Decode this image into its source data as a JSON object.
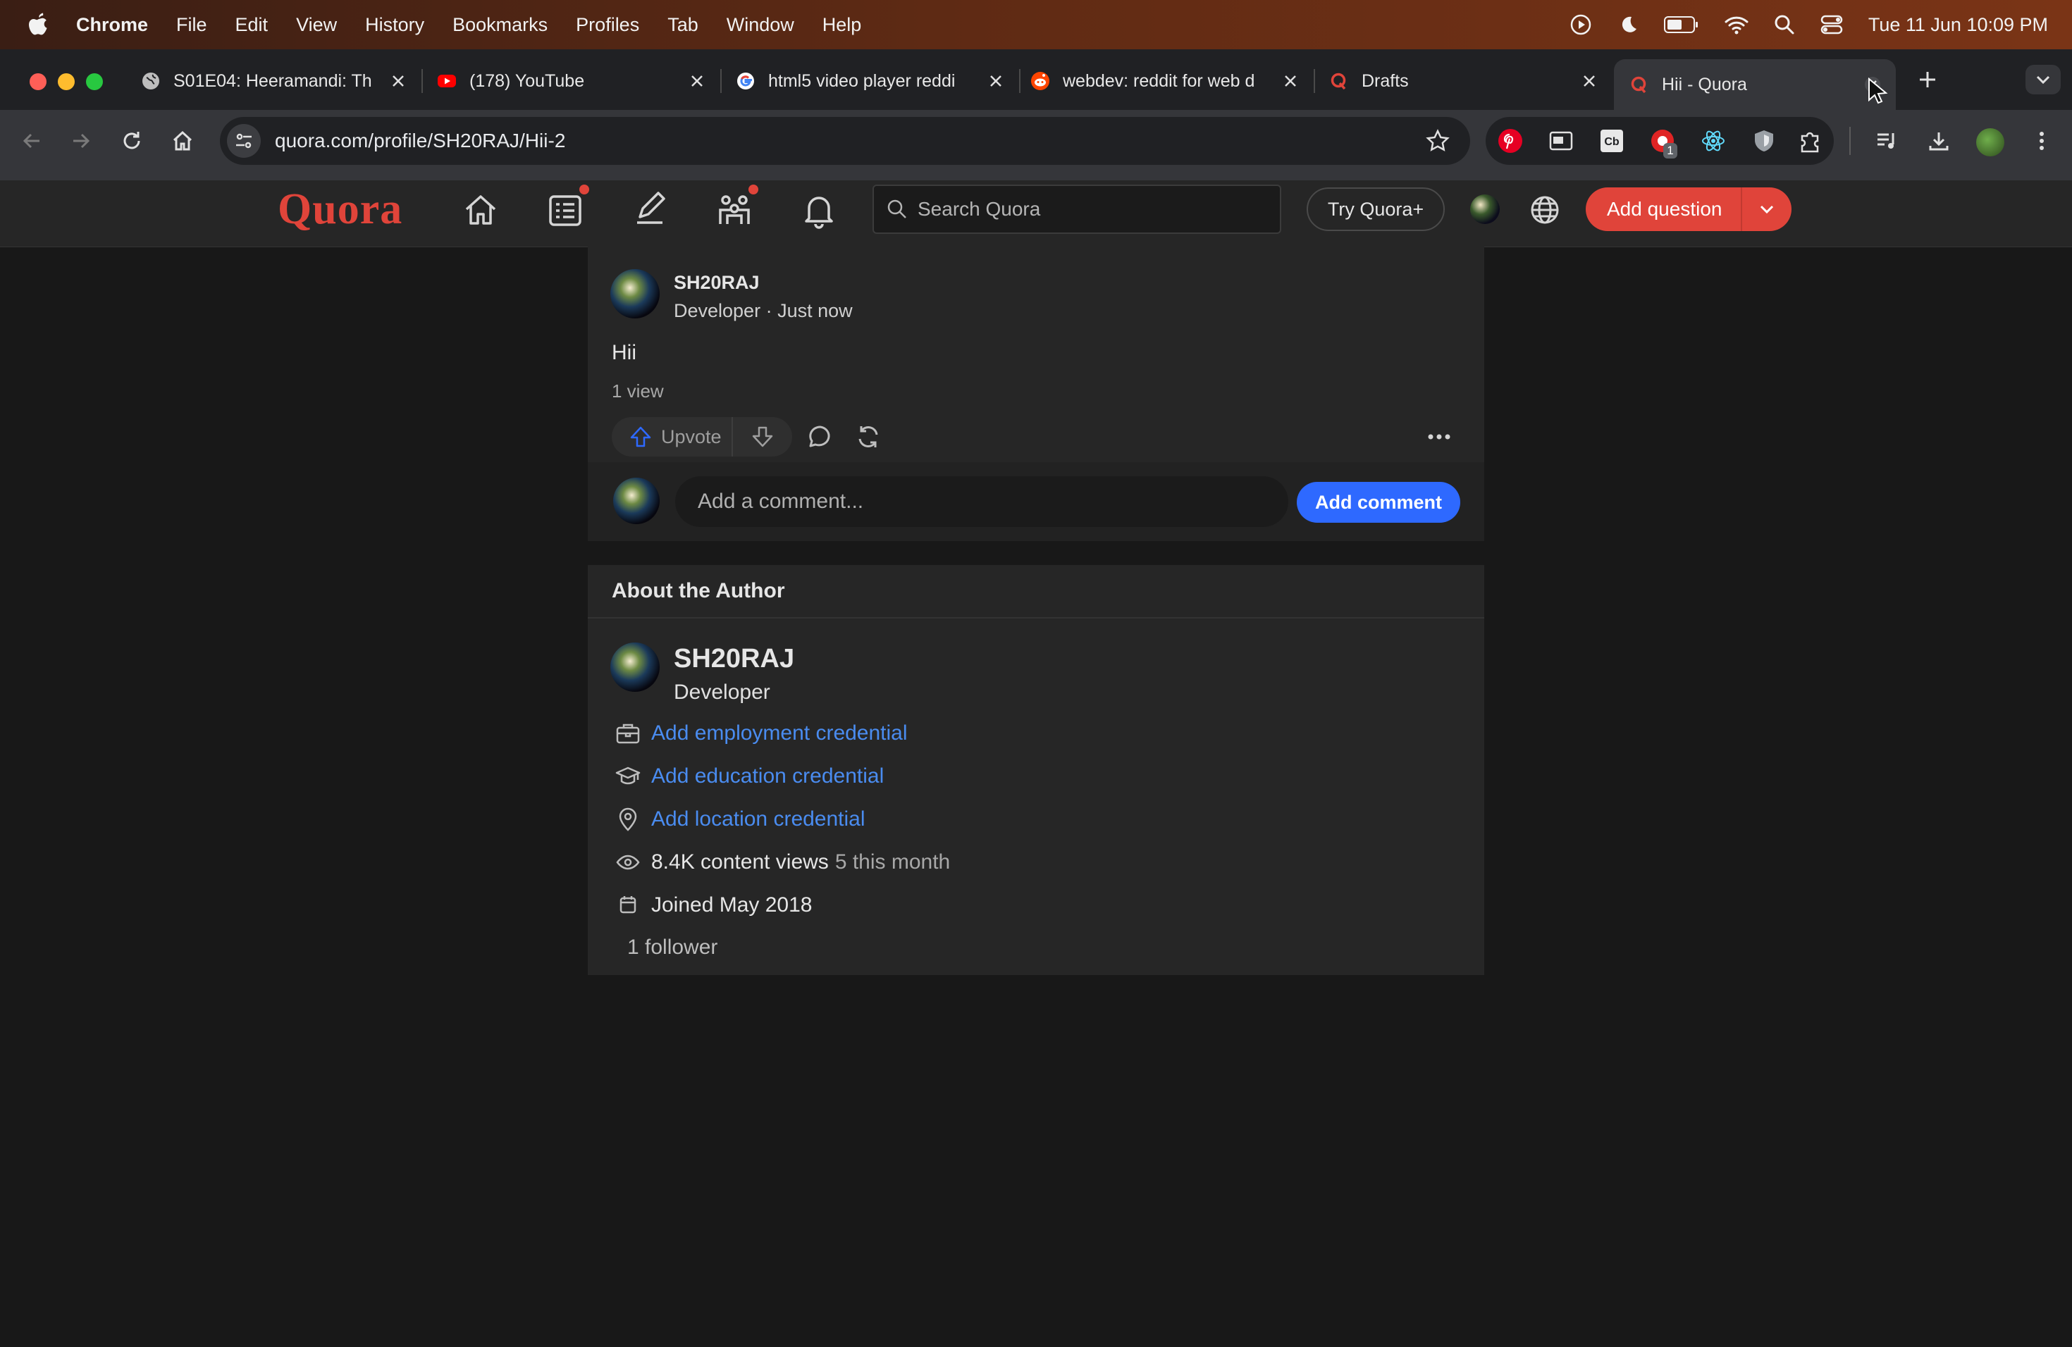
{
  "menubar": {
    "app_name": "Chrome",
    "menus": [
      "File",
      "Edit",
      "View",
      "History",
      "Bookmarks",
      "Profiles",
      "Tab",
      "Window",
      "Help"
    ],
    "clock": "Tue 11 Jun  10:09 PM"
  },
  "tabs": [
    {
      "title": "S01E04: Heeramandi: Th",
      "favicon": "globe-icon"
    },
    {
      "title": "(178) YouTube",
      "favicon": "youtube-icon"
    },
    {
      "title": "html5 video player reddi",
      "favicon": "google-icon"
    },
    {
      "title": "webdev: reddit for web d",
      "favicon": "reddit-icon"
    },
    {
      "title": "Drafts",
      "favicon": "quora-icon"
    },
    {
      "title": "Hii - Quora",
      "favicon": "quora-icon",
      "active": true
    }
  ],
  "address_bar": {
    "url": "quora.com/profile/SH20RAJ/Hii-2"
  },
  "extensions": {
    "badge_count": "1"
  },
  "quora_header": {
    "logo": "Quora",
    "search_placeholder": "Search Quora",
    "try_plus": "Try Quora+",
    "add_question": "Add question",
    "brand_color": "#e0443a"
  },
  "post": {
    "author": "SH20RAJ",
    "meta": "Developer · Just now",
    "body": "Hii",
    "views": "1 view",
    "upvote_label": "Upvote",
    "comment_placeholder": "Add a comment...",
    "add_comment_label": "Add comment"
  },
  "about": {
    "title": "About the Author",
    "name": "SH20RAJ",
    "tagline": "Developer",
    "employment": "Add employment credential",
    "education": "Add education credential",
    "location": "Add location credential",
    "content_views": "8.4K content views",
    "views_month": "5 this month",
    "joined": "Joined May 2018",
    "followers": "1 follower",
    "link_color": "#4a8cf0"
  }
}
